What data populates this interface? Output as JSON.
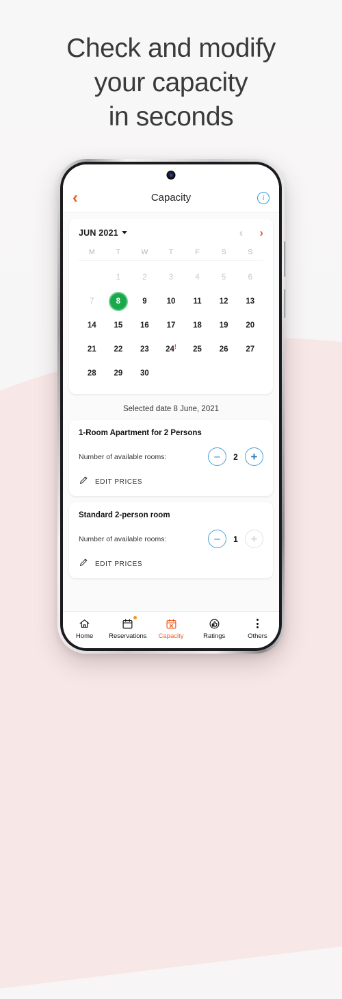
{
  "poster": {
    "headline_lines": [
      "Check and modify",
      "your capacity",
      "in seconds"
    ],
    "bg_top_color": "#f8f7f7",
    "bg_bottom_color": "#f7e7e6"
  },
  "appbar": {
    "back_icon": "chevron-left-icon",
    "title": "Capacity",
    "info_icon": "info-icon",
    "info_glyph": "i",
    "accent_color": "#f05a22",
    "info_color": "#2e9fe0"
  },
  "calendar": {
    "month_label": "JUN 2021",
    "dropdown_icon": "chevron-down-icon",
    "prev_icon": "chevron-left-icon",
    "next_icon": "chevron-right-icon",
    "prev_glyph": "‹",
    "next_glyph": "›",
    "prev_enabled": false,
    "next_enabled": true,
    "weekdays": [
      "M",
      "T",
      "W",
      "T",
      "F",
      "S",
      "S"
    ],
    "selected_day": 8,
    "selected_color": "#19a84b",
    "alert_marker": "!",
    "alert_color": "#e53935",
    "weeks": [
      [
        {
          "label": "",
          "state": "empty"
        },
        {
          "label": "1",
          "state": "muted"
        },
        {
          "label": "2",
          "state": "muted"
        },
        {
          "label": "3",
          "state": "muted"
        },
        {
          "label": "4",
          "state": "muted"
        },
        {
          "label": "5",
          "state": "muted"
        },
        {
          "label": "6",
          "state": "muted"
        }
      ],
      [
        {
          "label": "7",
          "state": "muted"
        },
        {
          "label": "8",
          "state": "selected"
        },
        {
          "label": "9",
          "state": "normal"
        },
        {
          "label": "10",
          "state": "normal"
        },
        {
          "label": "11",
          "state": "normal"
        },
        {
          "label": "12",
          "state": "normal"
        },
        {
          "label": "13",
          "state": "normal"
        }
      ],
      [
        {
          "label": "14",
          "state": "normal"
        },
        {
          "label": "15",
          "state": "normal"
        },
        {
          "label": "16",
          "state": "normal"
        },
        {
          "label": "17",
          "state": "normal"
        },
        {
          "label": "18",
          "state": "normal"
        },
        {
          "label": "19",
          "state": "normal"
        },
        {
          "label": "20",
          "state": "normal"
        }
      ],
      [
        {
          "label": "21",
          "state": "normal"
        },
        {
          "label": "22",
          "state": "normal"
        },
        {
          "label": "23",
          "state": "normal"
        },
        {
          "label": "24",
          "state": "normal",
          "alert": true
        },
        {
          "label": "25",
          "state": "normal"
        },
        {
          "label": "26",
          "state": "normal"
        },
        {
          "label": "27",
          "state": "normal"
        }
      ],
      [
        {
          "label": "28",
          "state": "normal"
        },
        {
          "label": "29",
          "state": "normal"
        },
        {
          "label": "30",
          "state": "normal"
        },
        {
          "label": "",
          "state": "empty"
        },
        {
          "label": "",
          "state": "empty"
        },
        {
          "label": "",
          "state": "empty"
        },
        {
          "label": "",
          "state": "empty"
        }
      ]
    ]
  },
  "selected_date_text": "Selected date 8 June, 2021",
  "rooms": [
    {
      "title": "1-Room Apartment for 2 Persons",
      "rooms_label": "Number of available rooms:",
      "quantity": "2",
      "minus_glyph": "–",
      "plus_glyph": "+",
      "minus_enabled": true,
      "plus_enabled": true,
      "edit_label": "EDIT PRICES",
      "edit_icon": "pencil-icon"
    },
    {
      "title": "Standard 2-person room",
      "rooms_label": "Number of available rooms:",
      "quantity": "1",
      "minus_glyph": "–",
      "plus_glyph": "+",
      "minus_enabled": true,
      "plus_enabled": false,
      "edit_label": "EDIT PRICES",
      "edit_icon": "pencil-icon"
    }
  ],
  "bottom_nav": {
    "active_color": "#f05a22",
    "badge_color": "#f7931e",
    "items": [
      {
        "label": "Home",
        "icon": "home-icon",
        "active": false,
        "badge": false
      },
      {
        "label": "Reservations",
        "icon": "calendar-icon",
        "active": false,
        "badge": true
      },
      {
        "label": "Capacity",
        "icon": "calendar-x-icon",
        "active": true,
        "badge": false
      },
      {
        "label": "Ratings",
        "icon": "thumbs-up-circle-icon",
        "active": false,
        "badge": false
      },
      {
        "label": "Others",
        "icon": "more-vertical-icon",
        "active": false,
        "badge": false
      }
    ]
  }
}
